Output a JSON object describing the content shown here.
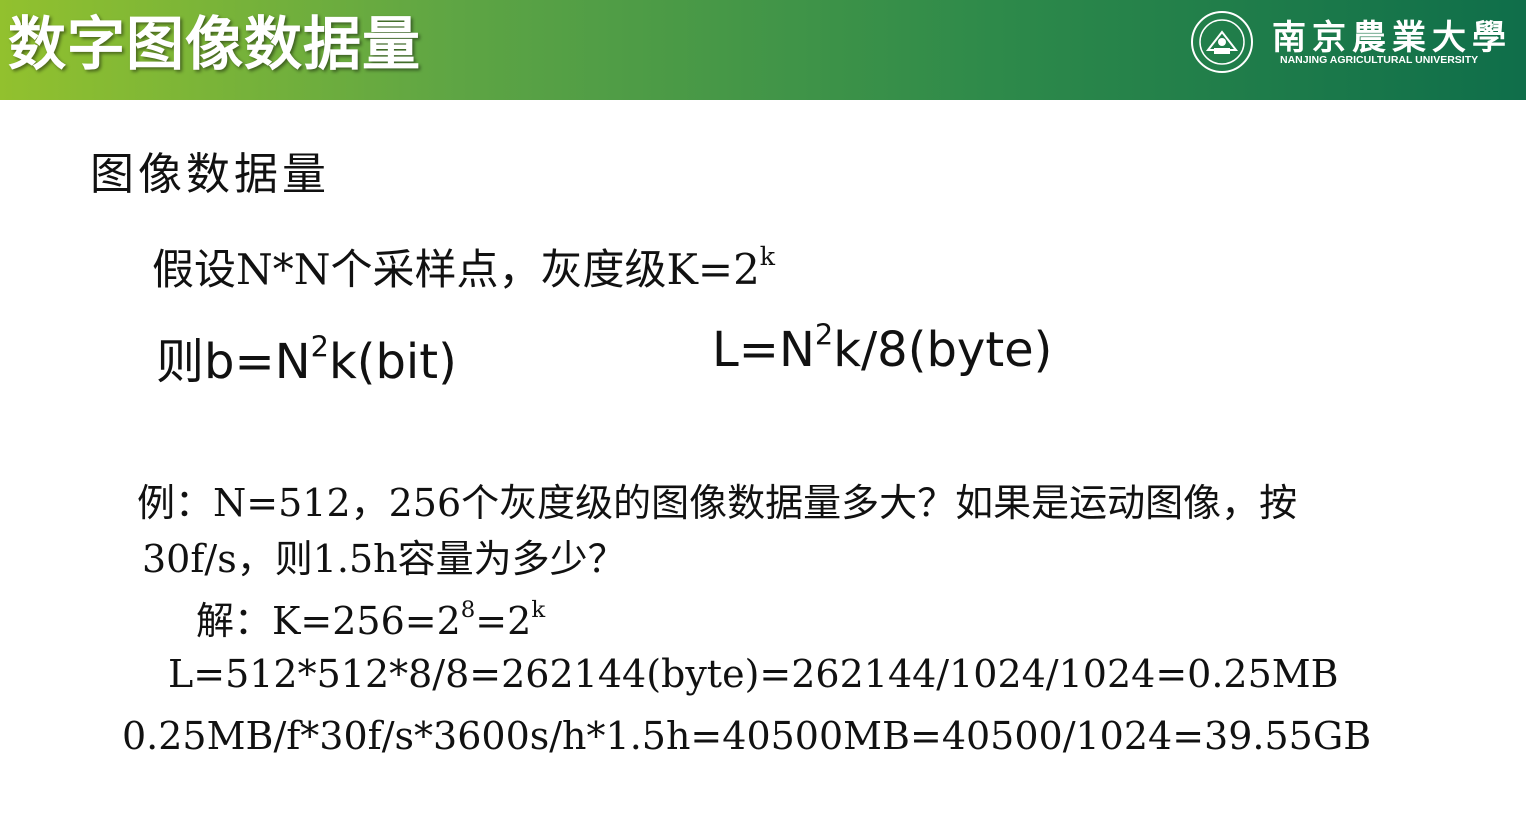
{
  "header": {
    "title": "数字图像数据量",
    "university_cn": "南京農業大學",
    "university_en": "NANJING AGRICULTURAL UNIVERSITY",
    "background_colors": [
      "#92c12e",
      "#5ea544",
      "#2e8a4a",
      "#0f6e4a"
    ],
    "title_color": "#ffffff"
  },
  "section_title": "图像数据量",
  "assumption": {
    "text": "假设N*N个采样点，灰度级K=2",
    "sup": "k"
  },
  "formula_bits": {
    "prefix": "则b=N",
    "sup": "2",
    "suffix": "k(bit)"
  },
  "formula_bytes": {
    "prefix": "L=N",
    "sup": "2",
    "suffix": "k/8(byte)"
  },
  "example": {
    "line1": "例：N=512，256个灰度级的图像数据量多大？如果是运动图像，按",
    "line2": "30f/s，则1.5h容量为多少？"
  },
  "solution": {
    "prefix": "解：K=256=2",
    "sup1": "8",
    "mid": "=2",
    "sup2": "k",
    "calc1": "L=512*512*8/8=262144(byte)=262144/1024/1024=0.25MB",
    "calc2": "0.25MB/f*30f/s*3600s/h*1.5h=40500MB=40500/1024=39.55GB"
  }
}
